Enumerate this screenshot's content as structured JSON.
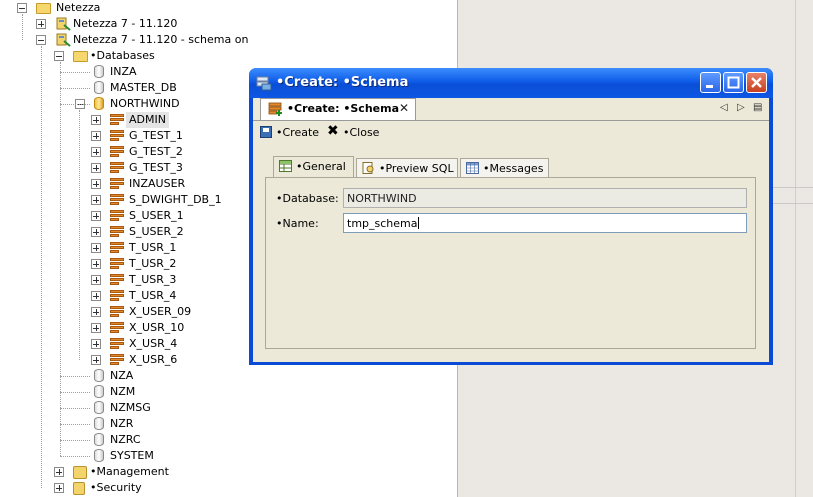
{
  "tree": {
    "root": "Netezza",
    "servers": [
      "Netezza 7 - 11.120",
      "Netezza 7 - 11.120 - schema on"
    ],
    "databases_label": "•Databases",
    "databases": [
      "INZA",
      "MASTER_DB",
      "NORTHWIND"
    ],
    "schemas": [
      "ADMIN",
      "G_TEST_1",
      "G_TEST_2",
      "G_TEST_3",
      "INZAUSER",
      "S_DWIGHT_DB_1",
      "S_USER_1",
      "S_USER_2",
      "T_USR_1",
      "T_USR_2",
      "T_USR_3",
      "T_USR_4",
      "X_USER_09",
      "X_USR_10",
      "X_USR_4",
      "X_USR_6"
    ],
    "other_databases": [
      "NZA",
      "NZM",
      "NZMSG",
      "NZR",
      "NZRC",
      "SYSTEM"
    ],
    "management_label": "•Management",
    "security_label": "•Security",
    "selected": "ADMIN"
  },
  "dialog": {
    "title": "•Create: •Schema",
    "editor_tab": "•Create: •Schema",
    "editor_tab_close": "✕",
    "nav_left": "◁",
    "nav_right": "▷",
    "nav_menu": "▤",
    "toolbar": {
      "create_label": "•Create",
      "close_label": "•Close",
      "close_glyph": "✖"
    },
    "tabs": [
      "•General",
      "•Preview SQL",
      "•Messages"
    ],
    "active_tab": "•General",
    "fields": {
      "database_label": "•Database:",
      "database_value": "NORTHWIND",
      "name_label": "•Name:",
      "name_value": "tmp_schema"
    }
  },
  "colors": {
    "titlebar": "#0b4ad4",
    "dialog_bg": "#ece9d8",
    "close_button": "#c5401f",
    "selection": "#e4e4e4"
  }
}
